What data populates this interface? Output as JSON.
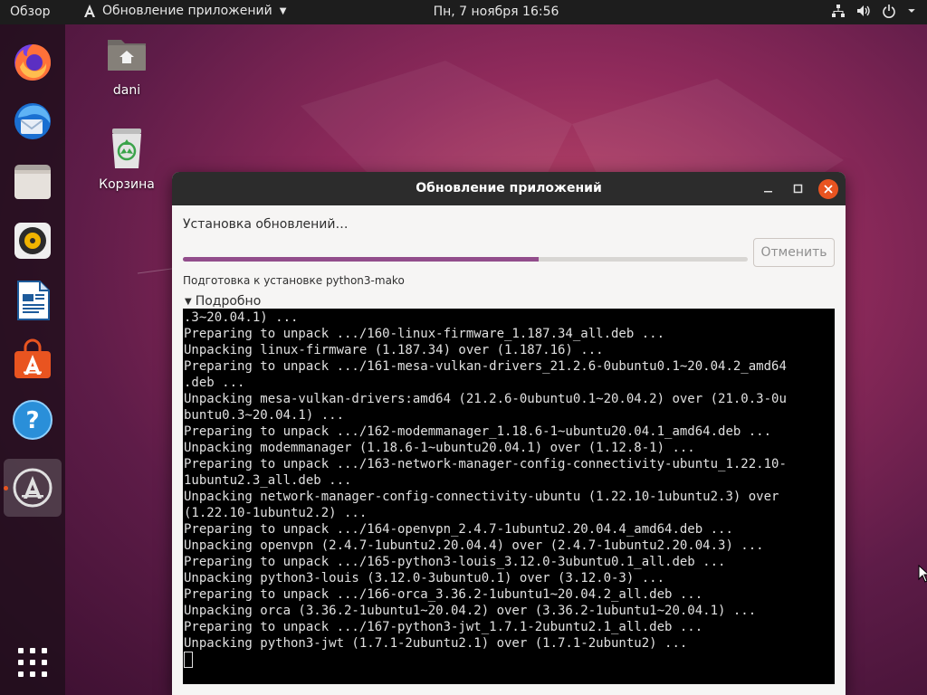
{
  "topbar": {
    "activities": "Обзор",
    "app_name": "Обновление приложений",
    "clock": "Пн, 7 ноября  16:56",
    "tray_icons": [
      "network-icon",
      "volume-icon",
      "power-icon",
      "chevron-down-icon"
    ]
  },
  "dock": {
    "items": [
      "firefox-icon",
      "thunderbird-icon",
      "files-icon",
      "rhythmbox-icon",
      "libreoffice-writer-icon",
      "ubuntu-software-icon",
      "help-icon",
      "software-updater-icon"
    ],
    "active_item": "software-updater-icon",
    "show_apps": "show-applications-icon"
  },
  "desktop": {
    "home_label": "dani",
    "trash_label": "Корзина"
  },
  "window": {
    "title": "Обновление приложений",
    "heading": "Установка обновлений…",
    "progress_percent": 63,
    "cancel_label": "Отменить",
    "status": "Подготовка к установке python3-mako",
    "details_label": "Подробно",
    "accent_color": "#924d8b",
    "close_color": "#e95420",
    "terminal_lines": [
      ".3~20.04.1) ...",
      "Preparing to unpack .../160-linux-firmware_1.187.34_all.deb ...",
      "Unpacking linux-firmware (1.187.34) over (1.187.16) ...",
      "Preparing to unpack .../161-mesa-vulkan-drivers_21.2.6-0ubuntu0.1~20.04.2_amd64",
      ".deb ...",
      "Unpacking mesa-vulkan-drivers:amd64 (21.2.6-0ubuntu0.1~20.04.2) over (21.0.3-0u",
      "buntu0.3~20.04.1) ...",
      "Preparing to unpack .../162-modemmanager_1.18.6-1~ubuntu20.04.1_amd64.deb ...",
      "Unpacking modemmanager (1.18.6-1~ubuntu20.04.1) over (1.12.8-1) ...",
      "Preparing to unpack .../163-network-manager-config-connectivity-ubuntu_1.22.10-",
      "1ubuntu2.3_all.deb ...",
      "Unpacking network-manager-config-connectivity-ubuntu (1.22.10-1ubuntu2.3) over",
      "(1.22.10-1ubuntu2.2) ...",
      "Preparing to unpack .../164-openvpn_2.4.7-1ubuntu2.20.04.4_amd64.deb ...",
      "Unpacking openvpn (2.4.7-1ubuntu2.20.04.4) over (2.4.7-1ubuntu2.20.04.3) ...",
      "Preparing to unpack .../165-python3-louis_3.12.0-3ubuntu0.1_all.deb ...",
      "Unpacking python3-louis (3.12.0-3ubuntu0.1) over (3.12.0-3) ...",
      "Preparing to unpack .../166-orca_3.36.2-1ubuntu1~20.04.2_all.deb ...",
      "Unpacking orca (3.36.2-1ubuntu1~20.04.2) over (3.36.2-1ubuntu1~20.04.1) ...",
      "Preparing to unpack .../167-python3-jwt_1.7.1-2ubuntu2.1_all.deb ...",
      "Unpacking python3-jwt (1.7.1-2ubuntu2.1) over (1.7.1-2ubuntu2) ..."
    ]
  }
}
